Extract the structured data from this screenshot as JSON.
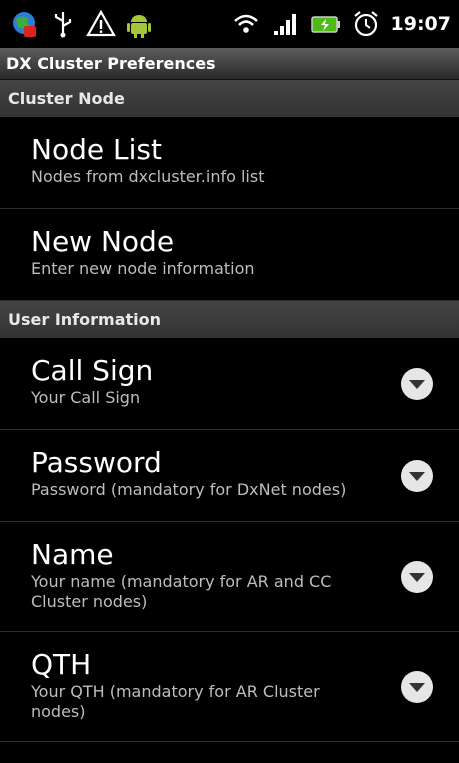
{
  "status_bar": {
    "time": "19:07",
    "icons": [
      "globe-notification-icon",
      "usb-icon",
      "warning-icon",
      "android-icon",
      "wifi-icon",
      "signal-icon",
      "battery-charging-icon",
      "alarm-icon"
    ]
  },
  "title_bar": {
    "title": "DX Cluster Preferences"
  },
  "categories": [
    {
      "label": "Cluster Node",
      "items": [
        {
          "title": "Node List",
          "summary": "Nodes from dxcluster.info list"
        },
        {
          "title": "New Node",
          "summary": "Enter new node information"
        }
      ]
    },
    {
      "label": "User Information",
      "items": [
        {
          "title": "Call Sign",
          "summary": "Your Call Sign"
        },
        {
          "title": "Password",
          "summary": "Password (mandatory for DxNet nodes)"
        },
        {
          "title": "Name",
          "summary": "Your name (mandatory for AR and CC Cluster nodes)"
        },
        {
          "title": "QTH",
          "summary": "Your QTH (mandatory for AR Cluster nodes)"
        }
      ]
    }
  ],
  "colors": {
    "background": "#000000",
    "category_bg": "#3a3a3a",
    "summary_text": "#bdbdbd"
  }
}
